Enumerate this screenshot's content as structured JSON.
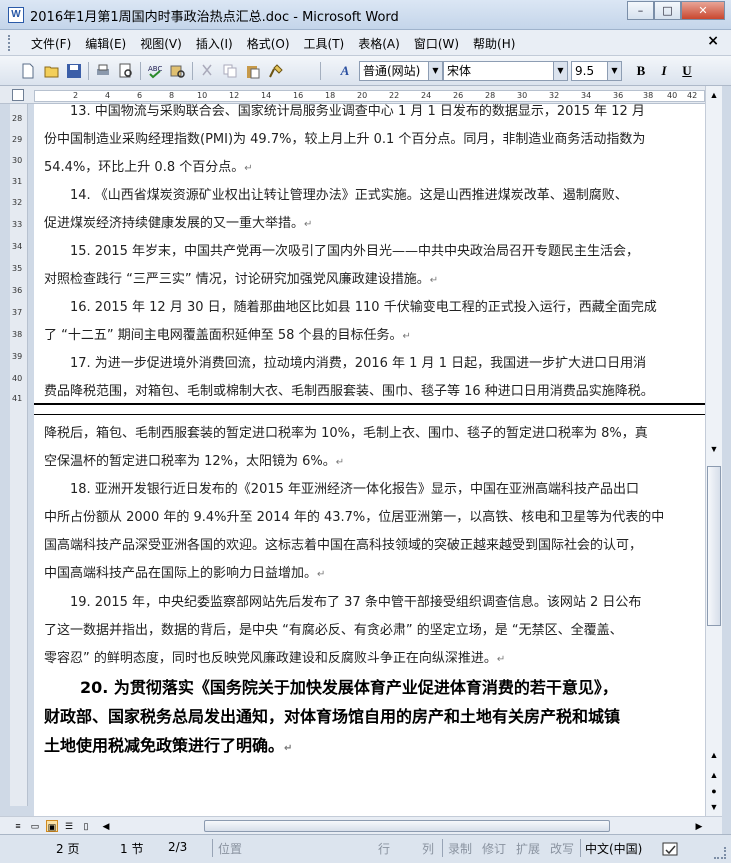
{
  "window": {
    "title": "2016年1月第1周国内时事政治热点汇总.doc - Microsoft Word",
    "app_icon": "W"
  },
  "window_buttons": {
    "minimize": "–",
    "restore": "□",
    "close": "✕"
  },
  "menu": {
    "items": [
      "文件(F)",
      "编辑(E)",
      "视图(V)",
      "插入(I)",
      "格式(O)",
      "工具(T)",
      "表格(A)",
      "窗口(W)",
      "帮助(H)"
    ],
    "close": "×"
  },
  "toolbar": {
    "style": "普通(网站)",
    "font": "宋体",
    "size": "9.5",
    "bold": "B",
    "italic": "I",
    "underline": "U",
    "style_icon": "A"
  },
  "ruler": {
    "ticks": [
      "2",
      "4",
      "6",
      "8",
      "10",
      "12",
      "14",
      "16",
      "18",
      "20",
      "22",
      "24",
      "26",
      "28",
      "30",
      "32",
      "34",
      "36",
      "38",
      "40",
      "42"
    ],
    "vticks": [
      "28",
      "29",
      "30",
      "31",
      "32",
      "33",
      "34",
      "35",
      "36",
      "37",
      "38",
      "39",
      "40",
      "41"
    ]
  },
  "pane1": {
    "lines": [
      "13. 中国物流与采购联合会、国家统计局服务业调查中心 1 月 1 日发布的数据显示，2015 年 12 月",
      "份中国制造业采购经理指数(PMI)为 49.7%，较上月上升 0.1 个百分点。同月，非制造业商务活动指数为",
      "54.4%，环比上升 0.8 个百分点。",
      "14. 《山西省煤炭资源矿业权出让转让管理办法》正式实施。这是山西推进煤炭改革、遏制腐败、",
      "促进煤炭经济持续健康发展的又一重大举措。",
      "15. 2015 年岁末，中国共产党再一次吸引了国内外目光——中共中央政治局召开专题民主生活会，",
      "对照检查践行 “三严三实” 情况，讨论研究加强党风廉政建设措施。",
      "16. 2015 年 12 月 30 日，随着那曲地区比如县 110 千伏输变电工程的正式投入运行，西藏全面完成",
      "了 “十二五” 期间主电网覆盖面积延伸至 58 个县的目标任务。",
      "17. 为进一步促进境外消费回流，拉动境内消费，2016 年 1 月 1 日起，我国进一步扩大进口日用消",
      "费品降税范围，对箱包、毛制或棉制大衣、毛制西服套装、围巾、毯子等 16 种进口日用消费品实施降税。"
    ]
  },
  "pane2": {
    "lines": [
      "降税后，箱包、毛制西服套装的暂定进口税率为 10%，毛制上衣、围巾、毯子的暂定进口税率为 8%，真",
      "空保温杯的暂定进口税率为 12%，太阳镜为 6%。",
      "18. 亚洲开发银行近日发布的《2015 年亚洲经济一体化报告》显示，中国在亚洲高端科技产品出口",
      "中所占份额从 2000 年的 9.4%升至 2014 年的 43.7%，位居亚洲第一，以高铁、核电和卫星等为代表的中",
      "国高端科技产品深受亚洲各国的欢迎。这标志着中国在高科技领域的突破正越来越受到国际社会的认可，",
      "中国高端科技产品在国际上的影响力日益增加。",
      "19. 2015 年，中央纪委监察部网站先后发布了 37 条中管干部接受组织调查信息。该网站 2 日公布",
      "了这一数据并指出，数据的背后，是中央 “有腐必反、有贪必肃” 的坚定立场，是 “无禁区、全覆盖、",
      "零容忍” 的鲜明态度，同时也反映党风廉政建设和反腐败斗争正在向纵深推进。"
    ],
    "big_lines": [
      "20. 为贯彻落实《国务院关于加快发展体育产业促进体育消费的若干意见》，",
      "财政部、国家税务总局发出通知，对体育场馆自用的房产和土地有关房产税和城镇",
      "土地使用税减免政策进行了明确。"
    ],
    "para_mark": "↵"
  },
  "statusbar": {
    "page": "2 页",
    "section": "1 节",
    "page_of": "2/3",
    "position": "位置",
    "line": "行",
    "column": "列",
    "record": "录制",
    "revise": "修订",
    "extend": "扩展",
    "overtype": "改写",
    "language": "中文(中国)"
  }
}
